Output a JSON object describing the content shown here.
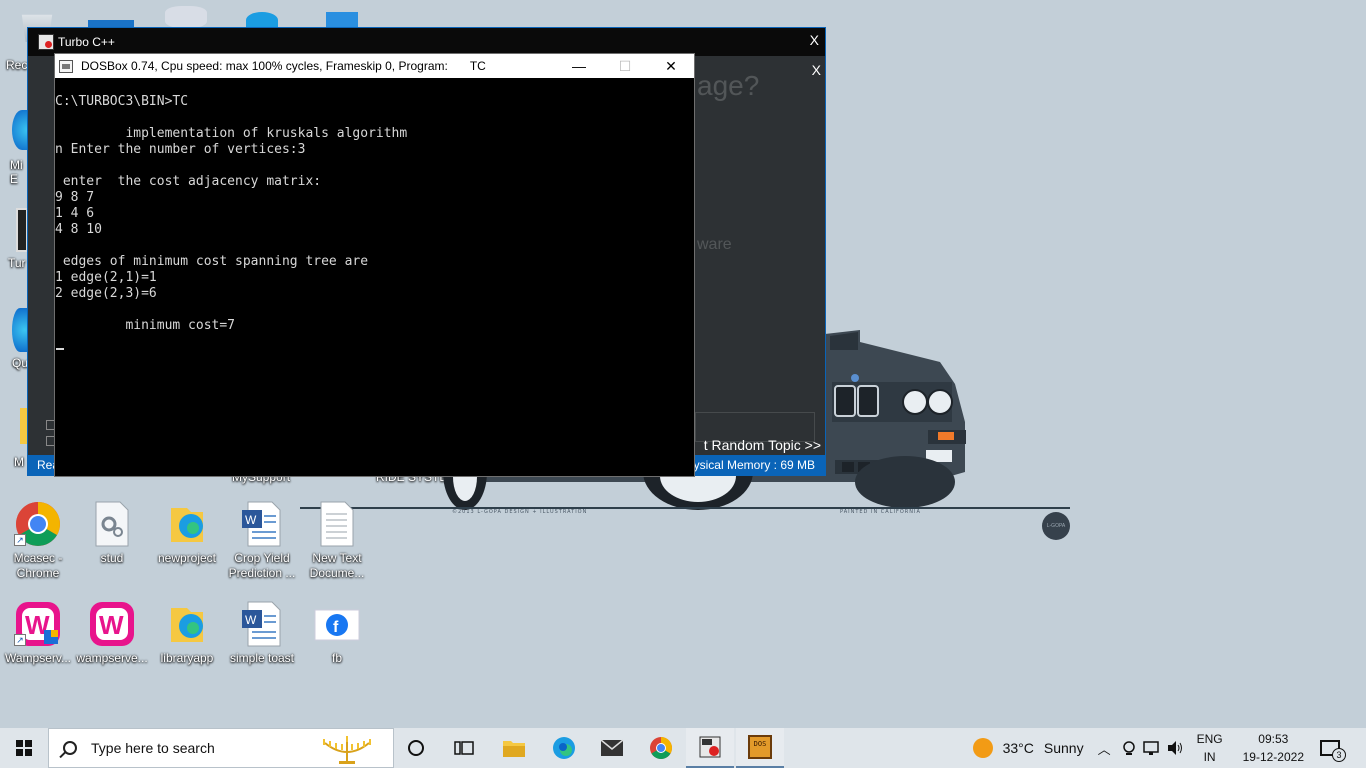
{
  "desktop": {
    "icons_row1": [
      {
        "label": "Mcasec - Chrome",
        "icon": "chrome-icon"
      },
      {
        "label": "stud",
        "icon": "settings-file-icon"
      },
      {
        "label": "newproject",
        "icon": "edge-folder-icon"
      },
      {
        "label": "Crop Yield Prediction ...",
        "icon": "word-doc-icon"
      },
      {
        "label": "New Text Docume...",
        "icon": "text-file-icon"
      }
    ],
    "icons_row2": [
      {
        "label": "Wampserv...",
        "icon": "wamp-icon"
      },
      {
        "label": "wampserve...",
        "icon": "wamp-icon"
      },
      {
        "label": "libraryapp",
        "icon": "edge-folder-icon"
      },
      {
        "label": "simple toast",
        "icon": "word-doc-icon"
      },
      {
        "label": "fb",
        "icon": "facebook-icon"
      }
    ],
    "partial_labels": {
      "recycle": "Rec",
      "mi": "Mi",
      "e": "E",
      "tur": "Tur",
      "qu": "Qu",
      "m": "M",
      "mysupport": "MySupport",
      "ride": "RIDE SYSTEM"
    },
    "wallpaper_captions": {
      "left": "©2013 L-GOPA DESIGN + ILLUSTRATION",
      "right": "PAINTED IN CALIFORNIA",
      "badge": "L-GOPA"
    }
  },
  "turbo_window": {
    "title": "Turbo C++",
    "close": "X",
    "inner_close": "X",
    "ghost_heading": "age?",
    "ghost_sub": "ware",
    "random_topic": "t Random Topic >>",
    "status_left": "Rea",
    "status_right": "ysical Memory : 69 MB"
  },
  "dosbox": {
    "title": "DOSBox 0.74, Cpu speed: max 100% cycles, Frameskip  0, Program:",
    "program": "TC",
    "minimize": "—",
    "maximize": "☐",
    "close": "✕",
    "lines": [
      "C:\\TURBOC3\\BIN>TC",
      "",
      "         implementation of kruskals algorithm",
      "n Enter the number of vertices:3",
      "",
      " enter  the cost adjacency matrix:",
      "9 8 7",
      "1 4 6",
      "4 8 10",
      "",
      " edges of minimum cost spanning tree are",
      "1 edge(2,1)=1",
      "2 edge(2,3)=6",
      "",
      "         minimum cost=7"
    ]
  },
  "taskbar": {
    "search_placeholder": "Type here to search",
    "weather_temp": "33°C",
    "weather_desc": "Sunny",
    "lang_top": "ENG",
    "lang_bottom": "IN",
    "time": "09:53",
    "date": "19-12-2022",
    "notification_count": "3",
    "dosbox_icon_text": "DOS"
  }
}
